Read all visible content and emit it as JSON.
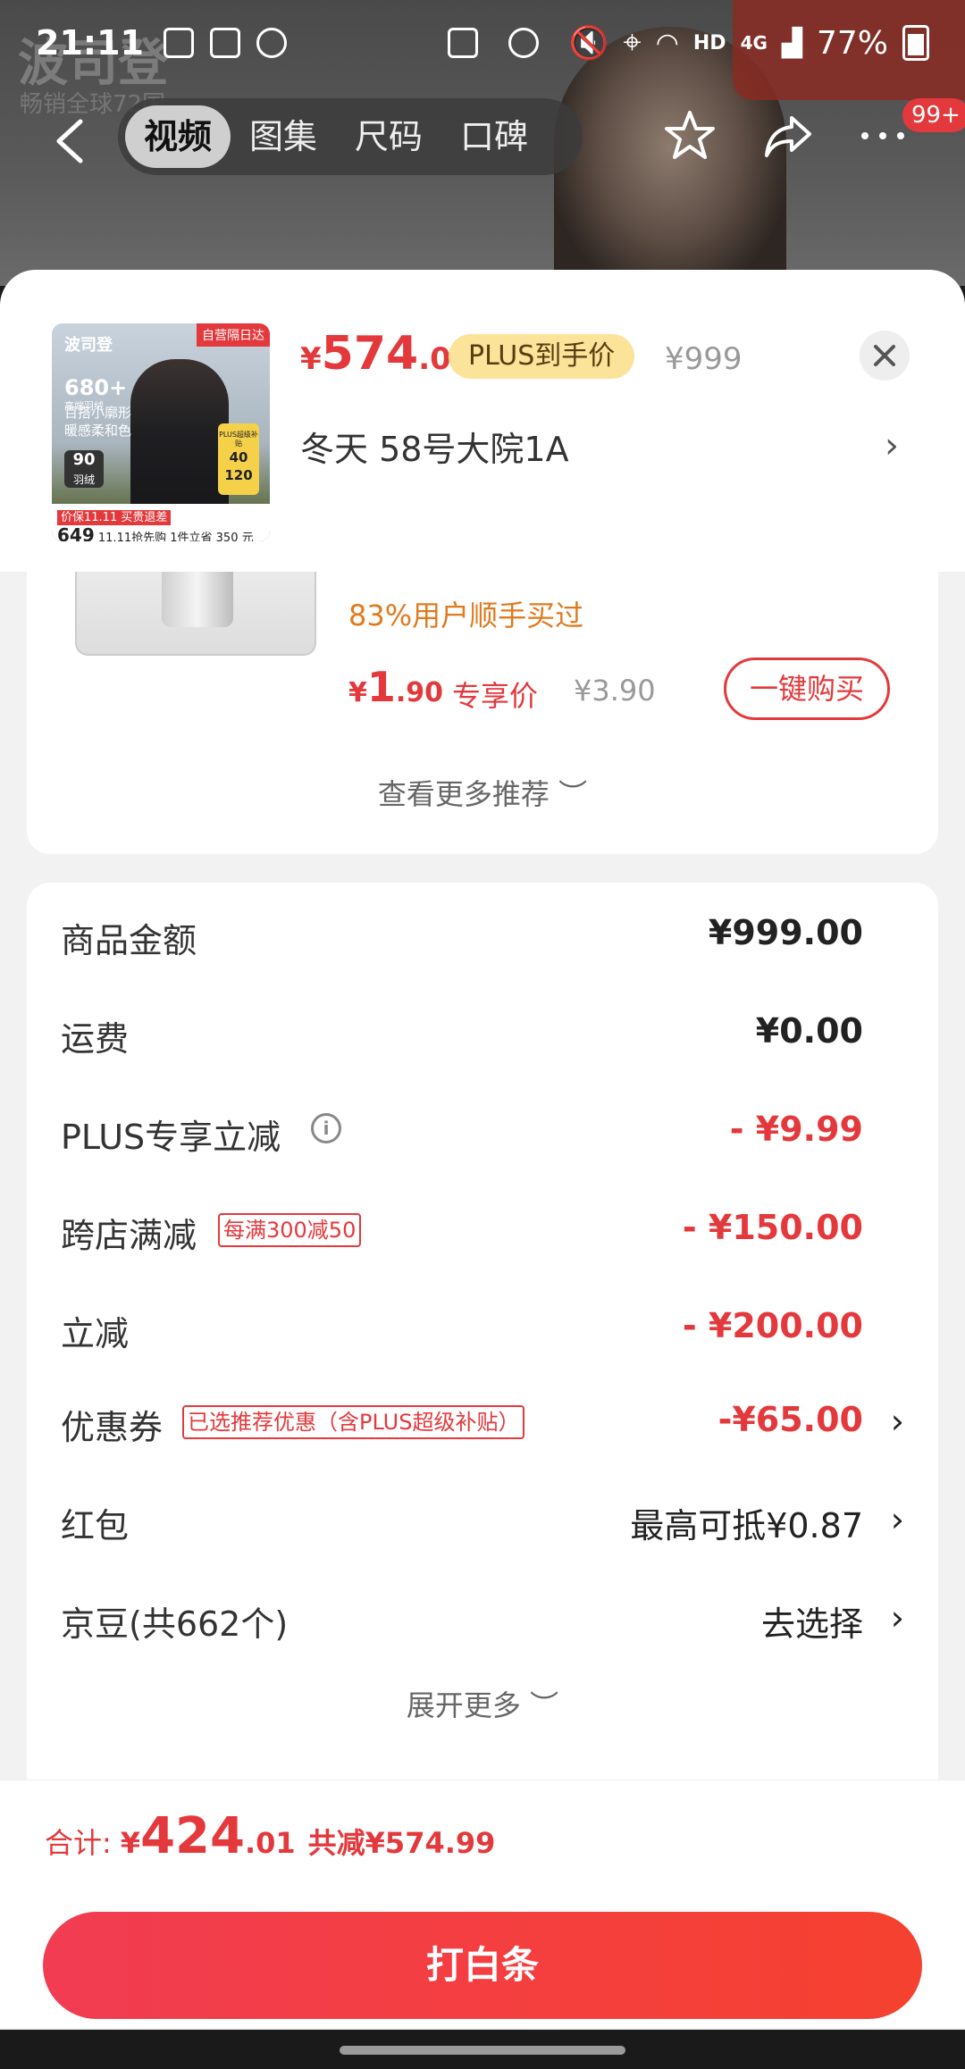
{
  "status_bar": {
    "time": "21:11",
    "battery": "77%",
    "network": "4G",
    "hd": "HD"
  },
  "background": {
    "brand_text": "波司登",
    "brand_sub": "畅销全球72国",
    "banner_text": "自营隔日达"
  },
  "nav": {
    "tabs": [
      "视频",
      "图集",
      "尺码",
      "口碑"
    ],
    "active_tab": "视频",
    "badge": "99+"
  },
  "product": {
    "image_tag": "自营隔日达",
    "image_texts": {
      "brand": "波司登",
      "count": "680+",
      "sub": "高端羽绒",
      "line1": "百搭小廓形",
      "line2": "暖感柔和色",
      "badge_num": "90",
      "badge_sub": "羽绒",
      "side1": "40",
      "side2": "120",
      "side_label": "PLUS超级补贴",
      "bottom_price_label": "价保11.11 买贵退差",
      "bottom_price": "649",
      "bottom_promo": "11.11抢先购",
      "bottom_save": "1件立省 350 元"
    },
    "price_symbol": "¥",
    "price_int": "574",
    "price_dec": ".01",
    "plus_tag": "PLUS到手价",
    "original_price": "¥999",
    "spec": "冬天  58号大院1A",
    "spec_arrow": "›"
  },
  "recommend": {
    "sold_text": "83%用户顺手买过",
    "price_symbol": "¥",
    "price_int": "1",
    "price_dec": ".90",
    "exclusive_label": "专享价",
    "original_price": "¥3.90",
    "buy_button": "一键购买",
    "more": "查看更多推荐 ︶"
  },
  "details": {
    "rows": [
      {
        "label": "商品金额",
        "value": "¥999.00"
      },
      {
        "label": "运费",
        "value": "¥0.00"
      },
      {
        "label": "PLUS专享立减",
        "value": "- ¥9.99",
        "info": "i"
      },
      {
        "label": "跨店满减",
        "tag": "每满300减50",
        "value": "- ¥150.00"
      },
      {
        "label": "立减",
        "value": "- ¥200.00"
      },
      {
        "label": "优惠券",
        "tag": "已选推荐优惠（含PLUS超级补贴）",
        "value": "-¥65.00",
        "chevron": "›"
      },
      {
        "label": "红包",
        "value": "最高可抵¥0.87",
        "chevron": "›"
      },
      {
        "label": "京豆(共662个)",
        "value": "去选择",
        "chevron": "›"
      }
    ],
    "expand": "展开更多 ︶"
  },
  "footer": {
    "total_label": "合计:",
    "total_symbol": "¥",
    "total_int": "424",
    "total_dec": ".01",
    "saved": "共减¥574.99",
    "pay_button": "打白条"
  },
  "colors": {
    "accent": "#e4393c",
    "plus_tag_bg": "#fbe39a",
    "orange": "#e07a1e"
  }
}
